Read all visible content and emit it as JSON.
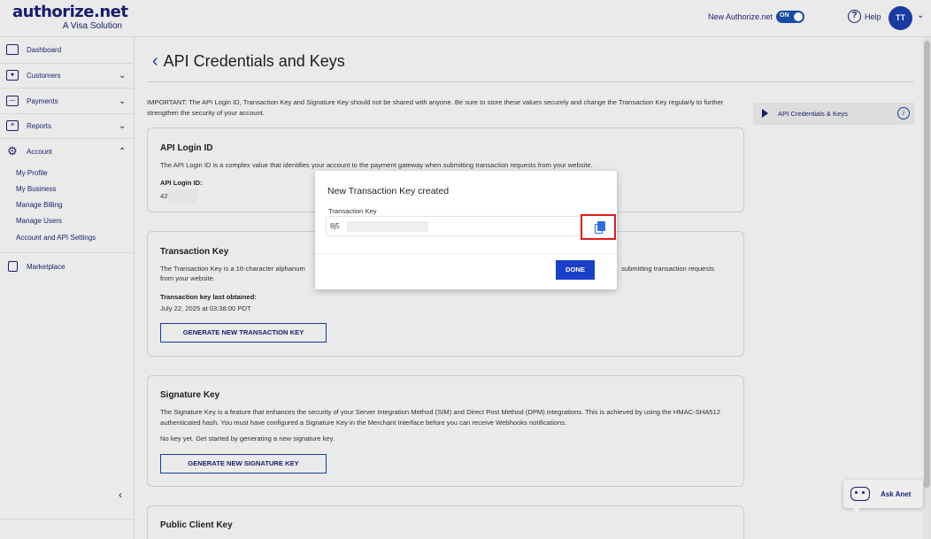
{
  "header": {
    "logo_main": "authorize.net",
    "logo_sub": "A Visa Solution",
    "new_toggle_label": "New Authorize.net",
    "toggle_state": "ON",
    "help_label": "Help",
    "avatar_initials": "TT"
  },
  "sidebar": {
    "items": [
      {
        "label": "Dashboard",
        "icon": "home-icon"
      },
      {
        "label": "Customers",
        "icon": "customers-icon"
      },
      {
        "label": "Payments",
        "icon": "payments-icon"
      },
      {
        "label": "Reports",
        "icon": "reports-icon"
      },
      {
        "label": "Account",
        "icon": "gear-icon"
      },
      {
        "label": "Marketplace",
        "icon": "bag-icon"
      }
    ],
    "account_subitems": [
      "My Profile",
      "My Business",
      "Manage Billing",
      "Manage Users",
      "Account and API Settings"
    ]
  },
  "page": {
    "title": "API Credentials and Keys",
    "important": "IMPORTANT: The API Login ID, Transaction Key and Signature Key should not be shared with anyone. Be sure to store these values securely and change the Transaction Key regularly to further strengthen the security of your account."
  },
  "cards": {
    "login": {
      "title": "API Login ID",
      "text": "The API Login ID is a complex value that identifies your account to the payment gateway when submitting transaction requests from your website.",
      "label": "API Login ID:",
      "value_prefix": "42"
    },
    "transaction": {
      "title": "Transaction Key",
      "text_left": "The Transaction Key is a 16-character alphanum",
      "text_right": "submitting transaction requests",
      "text_line2": "from your website.",
      "obtained_label": "Transaction key last obtained:",
      "obtained_value": "July 22, 2025 at 03:38:00 PDT",
      "button": "GENERATE NEW TRANSACTION KEY"
    },
    "signature": {
      "title": "Signature Key",
      "text": "The Signature Key is a feature that enhances the security of your Server Integration Method (SIM) and Direct Post Method (DPM) integrations. This is achieved by using the HMAC-SHA512 authenticated hash. You must have configured a Signature Key in the Merchant Interface before you can receive Webhooks notifications.",
      "no_key": "No key yet. Get started by generating a new signature key.",
      "button": "GENERATE NEW SIGNATURE KEY"
    },
    "public": {
      "title": "Public Client Key"
    }
  },
  "right_panel": {
    "label": "API Credentials & Keys"
  },
  "modal": {
    "title": "New Transaction Key created",
    "field_label": "Transaction Key",
    "value_prefix": "8j5",
    "done_button": "DONE"
  },
  "ask_anet": {
    "label": "Ask Anet"
  },
  "colors": {
    "brand_navy": "#1a1f71",
    "primary_blue": "#1a3fc9",
    "highlight_red": "#e31b1b"
  }
}
